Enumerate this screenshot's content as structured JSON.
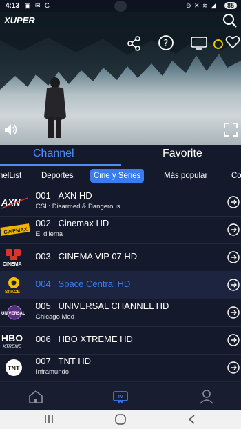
{
  "status_bar": {
    "time": "4:13",
    "battery": "85"
  },
  "app": {
    "logo": "XUPER",
    "logo_sub": ""
  },
  "tabs": {
    "channel": "Channel",
    "favorite": "Favorite"
  },
  "categories": [
    {
      "label": "nelList",
      "active": false
    },
    {
      "label": "Deportes",
      "active": false
    },
    {
      "label": "Cine y Series",
      "active": true
    },
    {
      "label": "Más popular",
      "active": false
    },
    {
      "label": "Co",
      "active": false
    }
  ],
  "channels": [
    {
      "number": "001",
      "name": "AXN HD",
      "program": "CSI : Disarmed & Dangerous",
      "logo": "AXN",
      "logo_icon": "axn-logo-icon"
    },
    {
      "number": "002",
      "name": "Cinemax HD",
      "program": "El dilema",
      "logo": "CINEMAX",
      "logo_icon": "cinemax-logo-icon"
    },
    {
      "number": "003",
      "name": "CINEMA VIP 07 HD",
      "program": "",
      "logo": "CINEMA",
      "logo_icon": "cinema-logo-icon"
    },
    {
      "number": "004",
      "name": "Space Central HD",
      "program": "",
      "logo": "SPACE",
      "logo_icon": "space-logo-icon",
      "selected": true
    },
    {
      "number": "005",
      "name": "UNIVERSAL CHANNEL HD",
      "program": "Chicago Med",
      "logo": "UNIVERSAL",
      "logo_icon": "universal-logo-icon"
    },
    {
      "number": "006",
      "name": "HBO XTREME HD",
      "program": "",
      "logo": "HBO XTREME",
      "logo_icon": "hbo-logo-icon"
    },
    {
      "number": "007",
      "name": "TNT HD",
      "program": "Inframundo",
      "logo": "TNT",
      "logo_icon": "tnt-logo-icon"
    }
  ],
  "colors": {
    "accent": "#3a7bf0",
    "background": "#14192b",
    "selected_row": "#1d2440"
  }
}
